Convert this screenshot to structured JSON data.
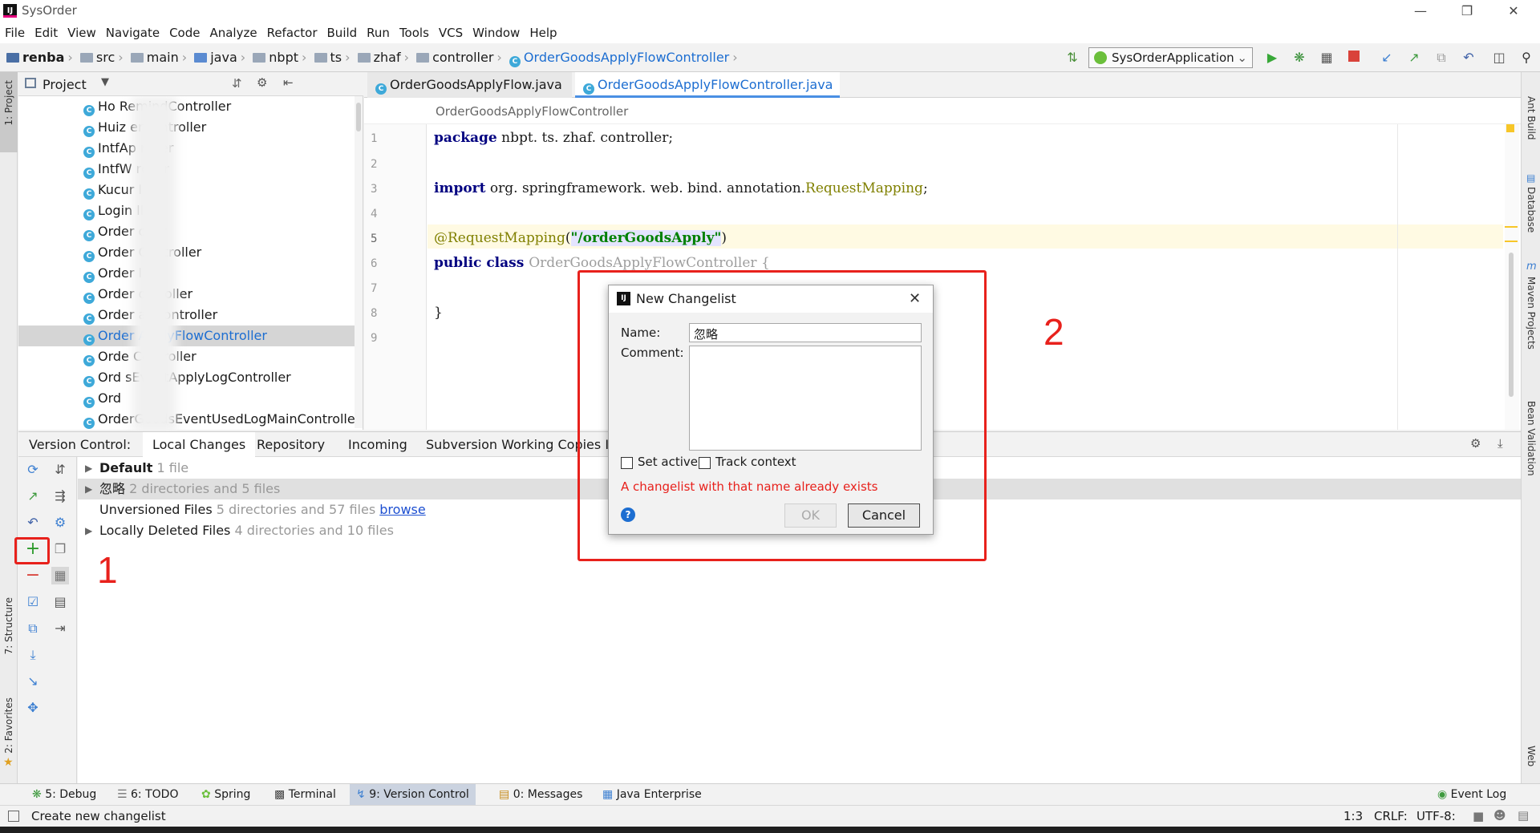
{
  "window": {
    "title": "SysOrder"
  },
  "menu": [
    "File",
    "Edit",
    "View",
    "Navigate",
    "Code",
    "Analyze",
    "Refactor",
    "Build",
    "Run",
    "Tools",
    "VCS",
    "Window",
    "Help"
  ],
  "breadcrumb": [
    "renba",
    "src",
    "main",
    "java",
    "nbpt",
    "ts",
    "zhaf",
    "controller",
    "OrderGoodsApplyFlowController"
  ],
  "run_config": "SysOrderApplication",
  "project_panel": {
    "title": "Project",
    "items": [
      {
        "label": "Ho          RemindController"
      },
      {
        "label": "Huiz         erController"
      },
      {
        "label": "IntfAp         roller"
      },
      {
        "label": "IntfW         roller"
      },
      {
        "label": "Kucur          ller"
      },
      {
        "label": "Login          ller"
      },
      {
        "label": "Order          oller"
      },
      {
        "label": "Order          Controller"
      },
      {
        "label": "Order          ller"
      },
      {
        "label": "Order          ontroller"
      },
      {
        "label": "Order          anController"
      },
      {
        "label": "Order          ApplyFlowController",
        "selected": true
      },
      {
        "label": "Orde          Controller"
      },
      {
        "label": "Ord          sEventApplyLogController"
      },
      {
        "label": "Ord"
      },
      {
        "label": "OrderGoodsEventUsedLogMainController"
      }
    ]
  },
  "editor": {
    "tabs": [
      {
        "label": "OrderGoodsApplyFlow.java",
        "active": false
      },
      {
        "label": "OrderGoodsApplyFlowController.java",
        "active": true
      }
    ],
    "breadcrumb": "OrderGoodsApplyFlowController",
    "line_numbers": [
      "1",
      "2",
      "3",
      "4",
      "5",
      "6",
      "7",
      "8",
      "9"
    ],
    "code": {
      "kw_package": "package",
      "package_name": " nbpt. ts. zhaf. controller;",
      "kw_import": "import",
      "import_path": " org. springframework. web. bind. annotation.",
      "import_class": "RequestMapping",
      "import_end": ";",
      "annotation": "@RequestMapping",
      "paren_open": "(",
      "annotation_value": "\"/orderGoodsApply\"",
      "paren_close": ")",
      "kw_public_class": "public class ",
      "class_name": "OrderGoodsApplyFlowController {",
      "close_brace": "}"
    }
  },
  "version_control": {
    "label": "Version Control:",
    "tabs": [
      "Local Changes",
      "Repository",
      "Incoming",
      "Subversion Working Copies Infor"
    ],
    "rows": [
      {
        "name": "Default",
        "detail": "1 file"
      },
      {
        "name": "忽略",
        "detail": "2 directories and 5 files"
      },
      {
        "name": "Unversioned Files",
        "detail": "5 directories and 57 files",
        "link": "browse"
      },
      {
        "name": "Locally Deleted Files",
        "detail": "4 directories and 10 files"
      }
    ]
  },
  "annotations": {
    "marker1": "1",
    "marker2": "2"
  },
  "dialog": {
    "title": "New Changelist",
    "name_label": "Name:",
    "name_value": "忽略",
    "comment_label": "Comment:",
    "set_active": "Set active",
    "track_context": "Track context",
    "error": "A changelist with that name already exists",
    "ok": "OK",
    "cancel": "Cancel"
  },
  "left_tool_windows": [
    "1: Project",
    "7: Structure",
    "2: Favorites"
  ],
  "right_tool_windows": [
    "Ant Build",
    "Database",
    "Maven Projects",
    "Bean Validation",
    "Web"
  ],
  "bottom_tabs": [
    {
      "label": "5: Debug"
    },
    {
      "label": "6: TODO"
    },
    {
      "label": "Spring"
    },
    {
      "label": "Terminal"
    },
    {
      "label": "9: Version Control",
      "active": true
    },
    {
      "label": "0: Messages"
    },
    {
      "label": "Java Enterprise"
    }
  ],
  "event_log": "Event Log",
  "status": {
    "message": "Create new changelist",
    "position": "1:3",
    "line_sep": "CRLF:",
    "encoding": "UTF-8:"
  },
  "colors": {
    "accent": "#4a8fe3",
    "error": "#e8211c",
    "selected_text": "#1d6ed1"
  }
}
